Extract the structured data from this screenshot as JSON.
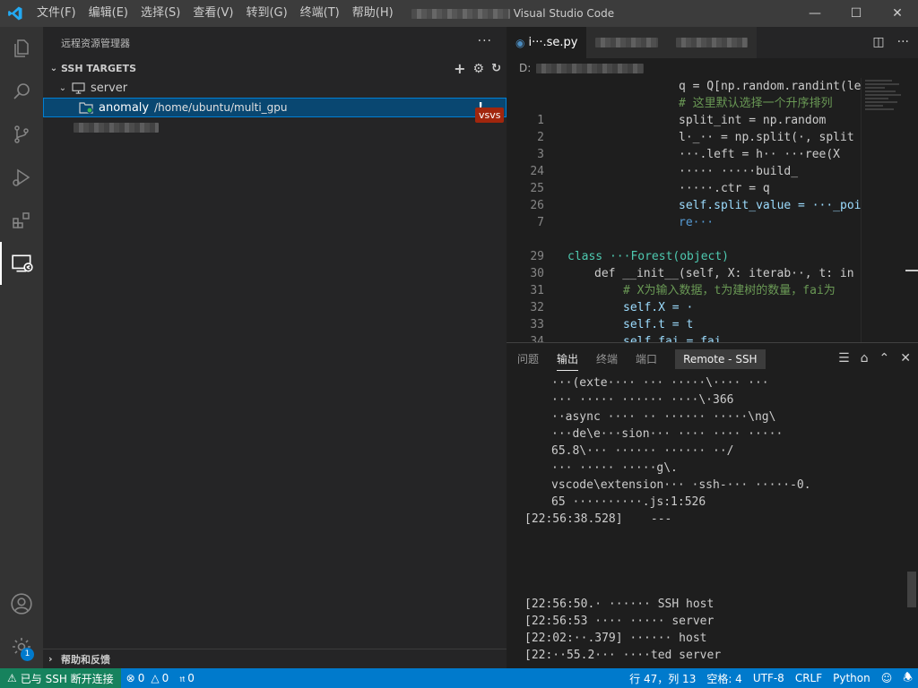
{
  "titlebar": {
    "menu": [
      "文件(F)",
      "编辑(E)",
      "选择(S)",
      "查看(V)",
      "转到(G)",
      "终端(T)",
      "帮助(H)"
    ],
    "window_title": "Visual Studio Code"
  },
  "activity": {
    "items": [
      "explorer-icon",
      "search-icon",
      "source-control-icon",
      "run-debug-icon",
      "extensions-icon",
      "remote-explorer-icon"
    ],
    "bottom": [
      "account-icon",
      "manage-gear-icon"
    ],
    "manage_badge": "1"
  },
  "sidebar": {
    "title": "远程资源管理器",
    "more": "···",
    "section_title": "SSH TARGETS",
    "server_label": "server",
    "connection_name": "anomaly",
    "connection_path": "/home/ubuntu/multi_gpu",
    "connection_flag": "!",
    "tooltip_badge": "vsvs",
    "help_title": "帮助和反馈"
  },
  "editor": {
    "tab_label": "i···.se.py",
    "breadcrumb": "D:",
    "lines": [
      {
        "n": "",
        "t": "q = Q[np.random.randint(len"
      },
      {
        "n": "",
        "t": "# 这里默认选择一个升序排列"
      },
      {
        "n": "1",
        "t": "split_int = np.random"
      },
      {
        "n": "2",
        "t": "l·_·· = np.split(·, split"
      },
      {
        "n": "3",
        "t": "···.left = h·· ···ree(X"
      },
      {
        "n": "24",
        "t": "····· ·····build_"
      },
      {
        "n": "25",
        "t": "·····.ctr = q"
      },
      {
        "n": "26",
        "t": "self.split_value = ···_poi"
      },
      {
        "n": "7",
        "t": "re···"
      },
      {
        "n": "",
        "t": ""
      },
      {
        "n": "29",
        "t": "class ···Forest(object)"
      },
      {
        "n": "30",
        "t": "def __init__(self, X: iterab··, t: in"
      },
      {
        "n": "31",
        "t": "# X为输入数据，t为建树的数量，fai为"
      },
      {
        "n": "32",
        "t": "self.X = ·"
      },
      {
        "n": "33",
        "t": "self.t = t"
      },
      {
        "n": "34",
        "t": "self.fai = fai"
      }
    ]
  },
  "panel": {
    "tabs": [
      "问题",
      "输出",
      "终端",
      "端口"
    ],
    "active_tab": "输出",
    "dropdown_value": "Remote - SSH",
    "output": [
      "···(exte···· ··· ·····\\···· ···",
      "··· ····· ······ ····\\·366",
      "··async ···· ·· ······ ·····\\ng\\",
      "···de\\e···sion··· ···· ···· ·····",
      "65.8\\··· ······ ······ ··/",
      "··· ····· ·····g\\.",
      "vscode\\extension··· ·ssh-··· ·····-0.",
      "65 ··········.js:1:526",
      "[22:56:38.528]    ---",
      "",
      "",
      "",
      "",
      "[22:56:50.· ······ SSH host",
      "[22:56:53 ···· ····· server",
      "[22:02:··.379] ······ host",
      "[22:··55.2··· ····ted server"
    ]
  },
  "status": {
    "remote": "已与 SSH 断开连接",
    "errors": "0",
    "warnings": "0",
    "ports": "0",
    "position": "行 47，列 13",
    "indent": "空格: 4",
    "encoding": "UTF-8",
    "eol": "CRLF",
    "language": "Python"
  }
}
